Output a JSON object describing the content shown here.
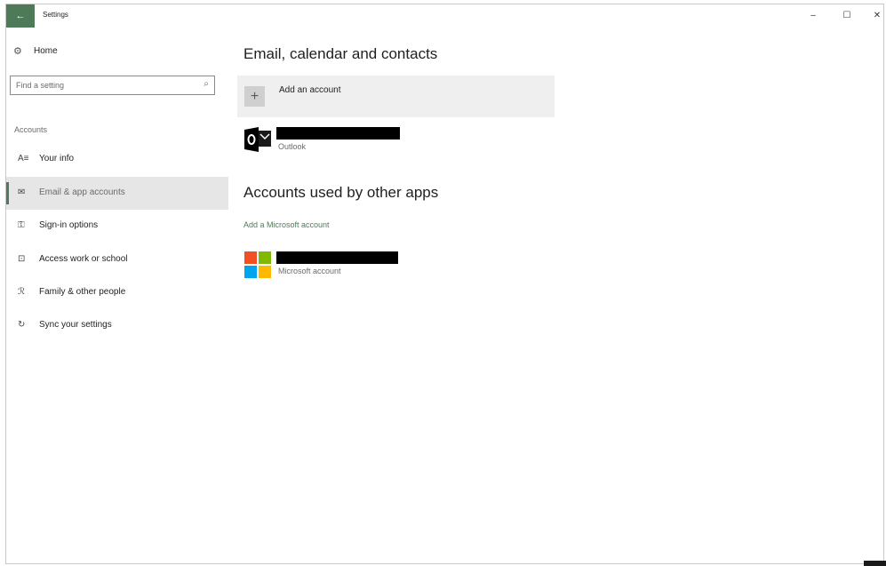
{
  "window": {
    "title": "Settings",
    "back_icon": "arrow-left-icon",
    "minimize": "–",
    "maximize": "☐",
    "close": "✕"
  },
  "sidebar": {
    "home_label": "Home",
    "search_placeholder": "Find a setting",
    "section_label": "Accounts",
    "items": [
      {
        "label": "Your info",
        "icon": "person-card-icon",
        "glyph": "A≡"
      },
      {
        "label": "Email & app accounts",
        "icon": "envelope-icon",
        "glyph": "✉",
        "selected": true
      },
      {
        "label": "Sign-in options",
        "icon": "key-icon",
        "glyph": "⚿"
      },
      {
        "label": "Access work or school",
        "icon": "briefcase-icon",
        "glyph": "⊡"
      },
      {
        "label": "Family & other people",
        "icon": "person-add-icon",
        "glyph": "ℛ"
      },
      {
        "label": "Sync your settings",
        "icon": "sync-icon",
        "glyph": "↻"
      }
    ]
  },
  "main": {
    "email_heading": "Email, calendar and contacts",
    "add_account_label": "Add an account",
    "add_account_icon": "+",
    "outlook_account": {
      "type_label": "Outlook",
      "icon": "outlook-icon"
    },
    "other_apps_heading": "Accounts used by other apps",
    "add_microsoft_link": "Add a Microsoft account",
    "microsoft_account": {
      "type_label": "Microsoft account",
      "icon": "microsoft-logo-icon"
    }
  },
  "colors": {
    "accent": "#4f7a5a",
    "selected_bg": "#e6e6e6",
    "add_account_bg": "#efefef",
    "ms_red": "#f25022",
    "ms_green": "#7fba00",
    "ms_blue": "#00a4ef",
    "ms_yellow": "#ffb900",
    "outlook_blue": "#000000"
  }
}
